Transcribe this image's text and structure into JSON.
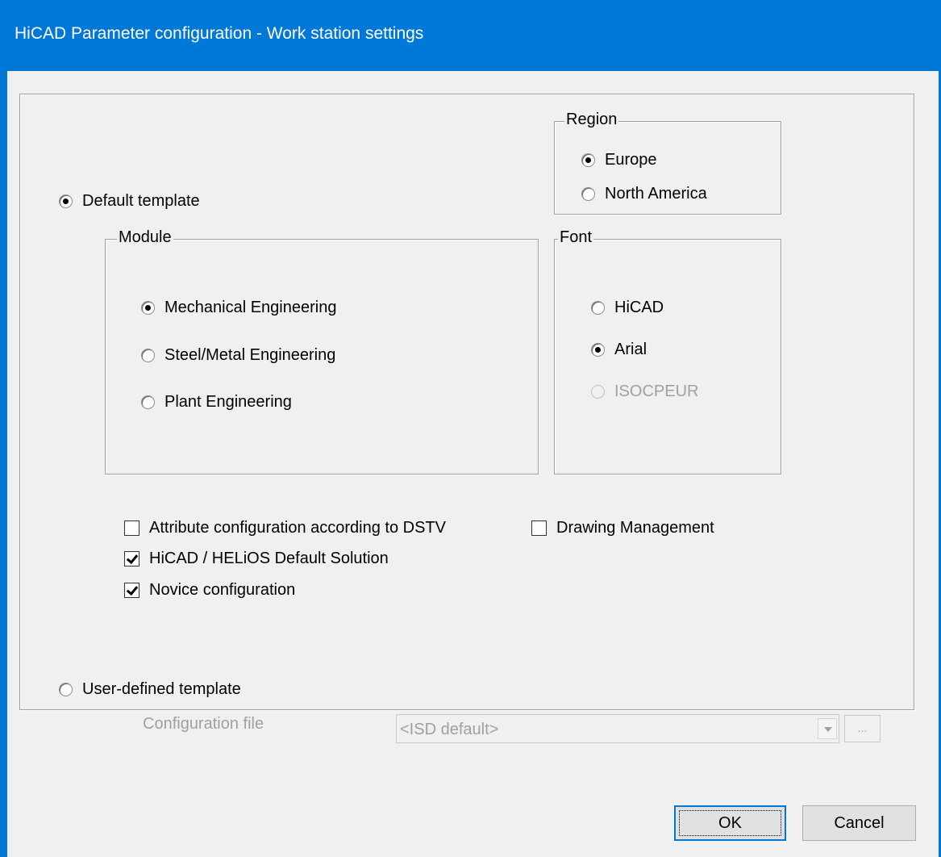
{
  "window": {
    "title": "HiCAD Parameter configuration - Work station settings"
  },
  "template": {
    "default_label": "Default template",
    "default_selected": true,
    "user_defined_label": "User-defined template",
    "user_defined_selected": false
  },
  "region": {
    "label": "Region",
    "options": [
      "Europe",
      "North America"
    ],
    "selected": "Europe"
  },
  "module": {
    "label": "Module",
    "options": [
      "Mechanical Engineering",
      "Steel/Metal Engineering",
      "Plant Engineering"
    ],
    "selected": "Mechanical Engineering"
  },
  "font": {
    "label": "Font",
    "options": [
      "HiCAD",
      "Arial",
      "ISOCPEUR"
    ],
    "selected": "Arial",
    "disabled": [
      "ISOCPEUR"
    ]
  },
  "checkboxes": {
    "dstv": {
      "label": "Attribute configuration according to DSTV",
      "checked": false
    },
    "drawing_management": {
      "label": "Drawing Management",
      "checked": false
    },
    "helios": {
      "label": "HiCAD / HELiOS Default Solution",
      "checked": true
    },
    "novice": {
      "label": "Novice configuration",
      "checked": true
    }
  },
  "config_file": {
    "label": "Configuration file",
    "value": "<ISD default>",
    "browse_label": "..."
  },
  "buttons": {
    "ok": "OK",
    "cancel": "Cancel"
  }
}
